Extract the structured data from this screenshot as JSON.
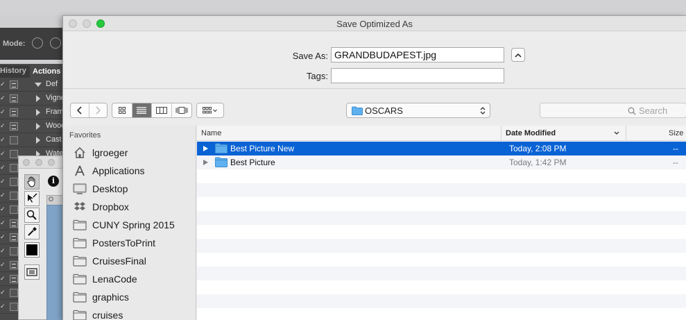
{
  "background_app": {
    "mode_label": "Mode:",
    "panel_tabs": [
      "History",
      "Actions"
    ],
    "action_rows": [
      {
        "label": "Def",
        "box": true,
        "tri": "down"
      },
      {
        "label": "Vignette",
        "box": true,
        "tri": "right"
      },
      {
        "label": "Frame",
        "box": true,
        "tri": "right"
      },
      {
        "label": "Wood",
        "box": true,
        "tri": "right"
      },
      {
        "label": "Cast",
        "box": false,
        "tri": "right"
      },
      {
        "label": "Water",
        "box": false,
        "tri": "right"
      },
      {
        "label": "",
        "box": false,
        "tri": ""
      },
      {
        "label": "",
        "box": false,
        "tri": ""
      },
      {
        "label": "",
        "box": false,
        "tri": ""
      },
      {
        "label": "",
        "box": false,
        "tri": ""
      },
      {
        "label": "",
        "box": true,
        "tri": ""
      },
      {
        "label": "",
        "box": true,
        "tri": ""
      },
      {
        "label": "",
        "box": false,
        "tri": ""
      },
      {
        "label": "",
        "box": true,
        "tri": ""
      },
      {
        "label": "",
        "box": true,
        "tri": ""
      },
      {
        "label": "",
        "box": false,
        "tri": ""
      },
      {
        "label": "",
        "box": false,
        "tri": ""
      }
    ],
    "tool_tab_label": "O"
  },
  "dialog": {
    "title": "Save Optimized As",
    "save_as_label": "Save As:",
    "save_as_value": "GRANDBUDAPEST.jpg",
    "tags_label": "Tags:",
    "tags_value": "",
    "location": "OSCARS",
    "search_placeholder": "Search",
    "accent_color": "#0a63d5"
  },
  "sidebar": {
    "heading": "Favorites",
    "items": [
      {
        "label": "lgroeger",
        "icon": "home-icon"
      },
      {
        "label": "Applications",
        "icon": "applications-icon"
      },
      {
        "label": "Desktop",
        "icon": "desktop-icon"
      },
      {
        "label": "Dropbox",
        "icon": "dropbox-icon"
      },
      {
        "label": "CUNY Spring 2015",
        "icon": "folder-icon"
      },
      {
        "label": "PostersToPrint",
        "icon": "folder-icon"
      },
      {
        "label": "CruisesFinal",
        "icon": "folder-icon"
      },
      {
        "label": "LenaCode",
        "icon": "folder-icon"
      },
      {
        "label": "graphics",
        "icon": "folder-icon"
      },
      {
        "label": "cruises",
        "icon": "folder-icon"
      }
    ]
  },
  "filelist": {
    "columns": {
      "name": "Name",
      "date": "Date Modified",
      "size": "Size"
    },
    "rows": [
      {
        "name": "Best Picture New",
        "date": "Today, 2:08 PM",
        "size": "--",
        "selected": true
      },
      {
        "name": "Best Picture",
        "date": "Today, 1:42 PM",
        "size": "--",
        "selected": false
      }
    ]
  }
}
